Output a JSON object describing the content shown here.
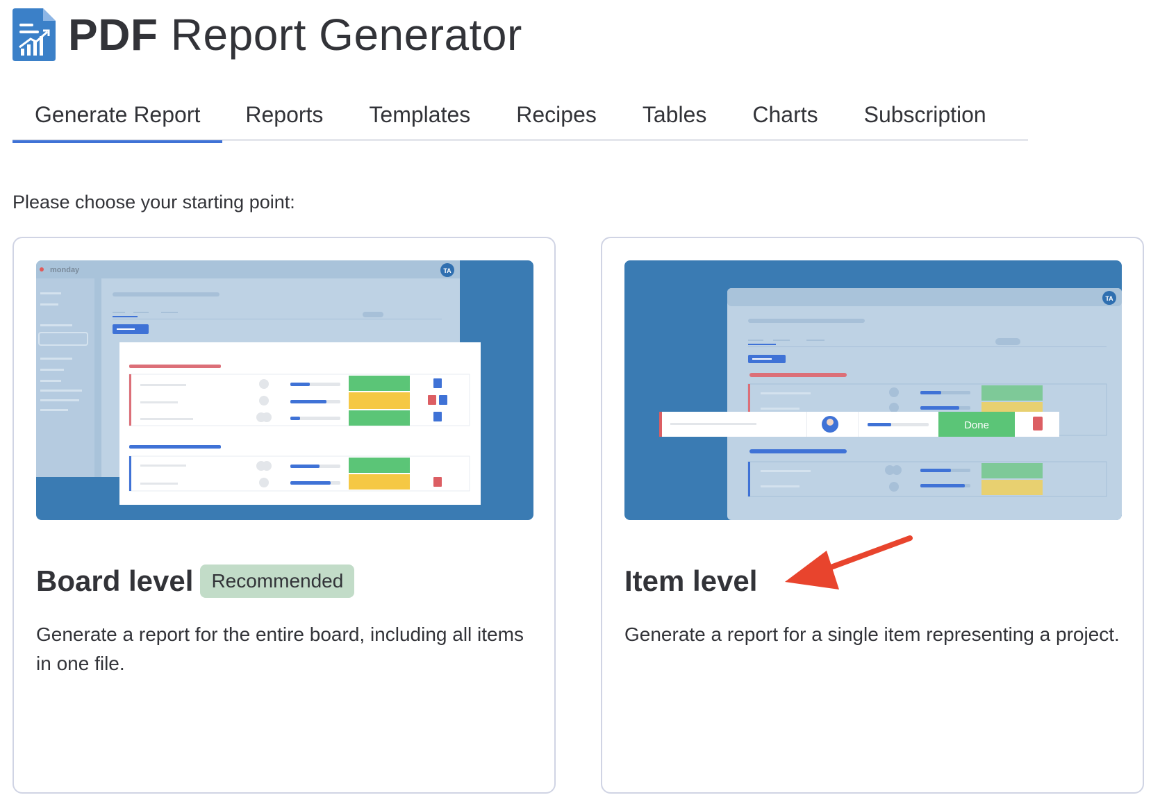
{
  "app": {
    "title_bold": "PDF",
    "title_rest": "Report Generator",
    "brand_color": "#3b80c8"
  },
  "tabs": [
    {
      "label": "Generate Report",
      "active": true
    },
    {
      "label": "Reports",
      "active": false
    },
    {
      "label": "Templates",
      "active": false
    },
    {
      "label": "Recipes",
      "active": false
    },
    {
      "label": "Tables",
      "active": false
    },
    {
      "label": "Charts",
      "active": false
    },
    {
      "label": "Subscription",
      "active": false
    }
  ],
  "main": {
    "prompt": "Please choose your starting point:",
    "cards": [
      {
        "title": "Board level",
        "badge": "Recommended",
        "description": "Generate a report for the entire board, including all items in one file.",
        "preview": {
          "brand": "monday",
          "avatar": "TA"
        }
      },
      {
        "title": "Item level",
        "description": "Generate a report for a single item representing a project.",
        "preview": {
          "avatar": "TA",
          "status": "Done"
        }
      }
    ]
  },
  "colors": {
    "accent": "#3f72d6",
    "done_green": "#5bc577",
    "working_yellow": "#f5c844",
    "stuck_red": "#dc5e63",
    "arrow_red": "#e8442d",
    "badge_bg": "#c2dcc8"
  },
  "icons": [
    "pdf-report-logo-icon",
    "arrow-pointer-icon",
    "file-icon",
    "pdf-file-icon",
    "avatar-icon"
  ]
}
